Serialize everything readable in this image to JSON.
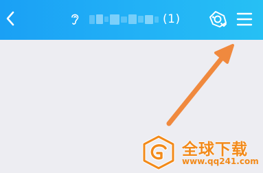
{
  "header": {
    "back_icon": "chevron-left-icon",
    "title_icon": "ear-icon",
    "member_count": "(1)",
    "action_icon": "sticker-icon",
    "menu_icon": "hamburger-menu-icon"
  },
  "watermark": {
    "brand": "全球下载",
    "url": "www.qq241.com",
    "color": "#f28a1a"
  },
  "annotation": {
    "arrow_color": "#f0893e"
  },
  "colors": {
    "header_start": "#1aa0f5",
    "header_end": "#26c0f4",
    "background": "#ededf2"
  }
}
